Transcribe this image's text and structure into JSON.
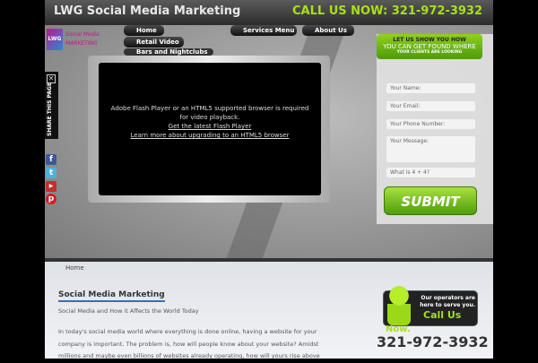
{
  "header": {
    "title": "LWG Social Media Marketing",
    "call_now": "CALL US NOW: 321-972-3932"
  },
  "logo": {
    "text": "Social Media MARKETING",
    "badge": "LWG"
  },
  "menu": [
    {
      "label": "Home"
    },
    {
      "label": "Retail Video"
    },
    {
      "label": "Bars and Nightclubs Video"
    },
    {
      "label": "Services Menu"
    },
    {
      "label": "About Us"
    }
  ],
  "video": {
    "message": "Adobe Flash Player or an HTML5 supported browser is required for video playback.",
    "link1": "Get the latest Flash Player",
    "link2": "Learn more about upgrading to an HTML5 browser"
  },
  "share": {
    "label": "SHARE THIS PAGE"
  },
  "social": [
    {
      "name": "facebook",
      "glyph": "f"
    },
    {
      "name": "twitter",
      "glyph": "t"
    },
    {
      "name": "youtube",
      "glyph": "▶"
    },
    {
      "name": "pinterest",
      "glyph": "p"
    }
  ],
  "form": {
    "line1": "LET US SHOW YOU HOW",
    "line2": "YOU CAN GET FOUND WHERE",
    "line3": "YOUR CLIENTS ARE LOOKING",
    "name": "Your Name:",
    "email": "Your Email:",
    "phone": "Your Phone Number:",
    "message": "Your Message:",
    "captcha": "What is 4 + 4?",
    "submit": "SUBMIT"
  },
  "content": {
    "breadcrumb": "Home",
    "title": "Social Media Marketing",
    "subtitle": "Social Media and How it Affects the World Today",
    "paragraph": "In today's social media world where everything is done online, having a website for your company is important. The problem is, how will people know about your website? Amidst millions and maybe even billions of websites already operating, how will yours rise above"
  },
  "call": {
    "text": "Our operators are here to serve you.",
    "call_us": "Call Us",
    "now": "Now.",
    "phone": "321-972-3932"
  },
  "colors": {
    "accent": "#a6e01c",
    "link": "#3a6fb0"
  }
}
